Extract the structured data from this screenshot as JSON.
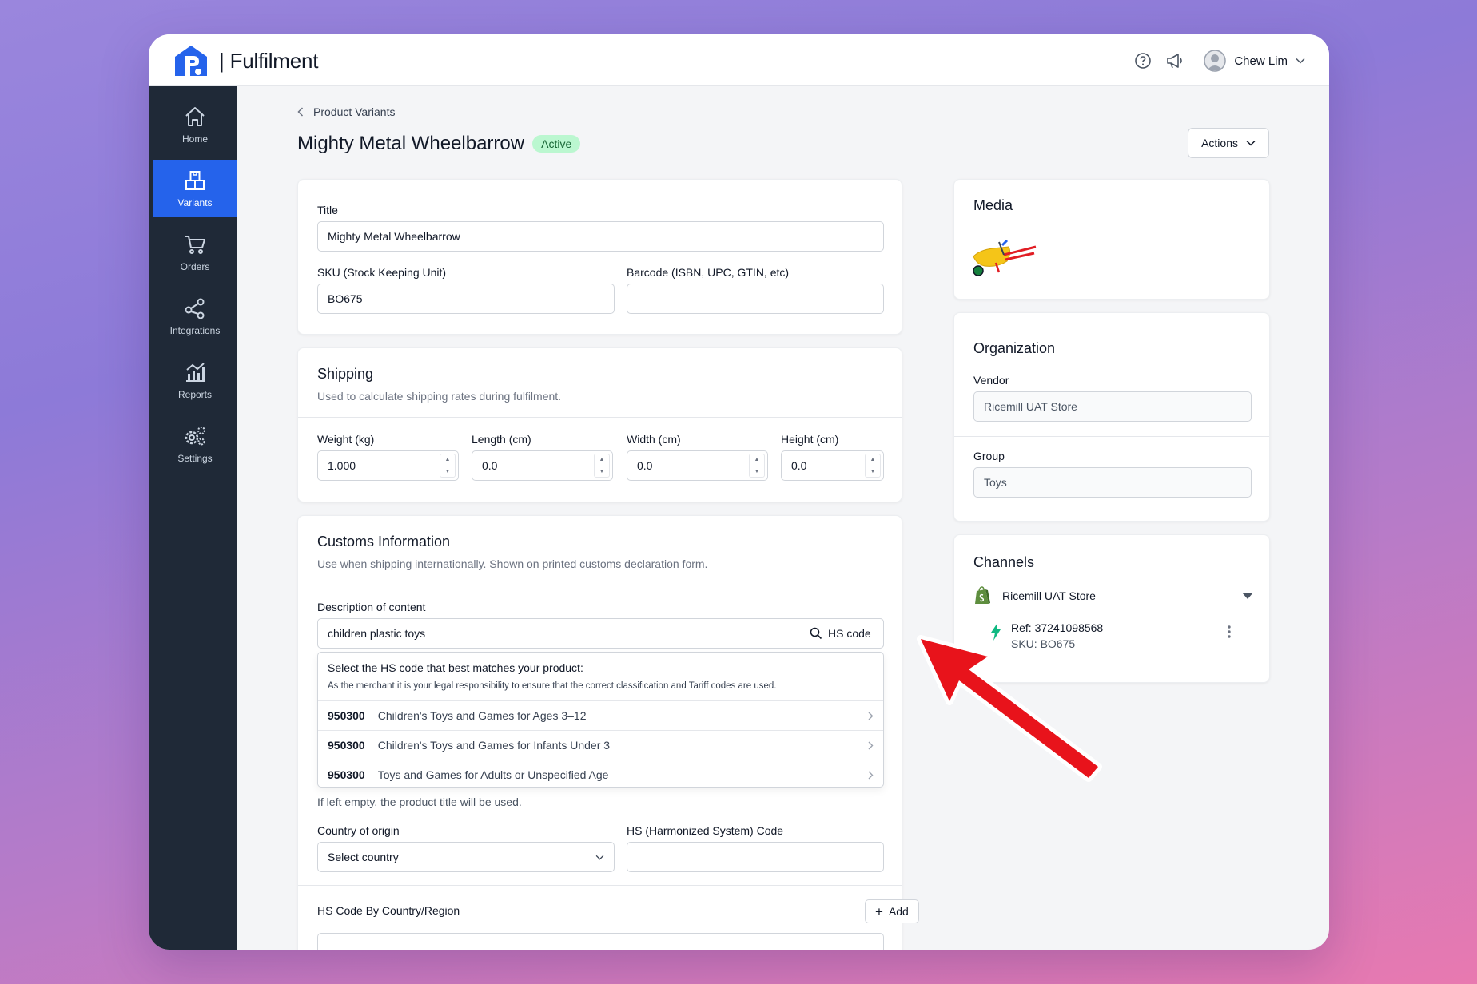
{
  "app": {
    "brand": "| Fulfilment",
    "user_name": "Chew Lim"
  },
  "icons": {
    "help": "help-circle-icon",
    "announce": "megaphone-icon",
    "user": "user-avatar-icon"
  },
  "colors": {
    "accent": "#2563eb",
    "sidebar": "#1f2937",
    "active_badge_bg": "#bbf7d0",
    "active_badge_text": "#166534",
    "annotation_arrow": "#e8131b"
  },
  "sidebar": {
    "items": [
      {
        "label": "Home",
        "icon": "home-icon"
      },
      {
        "label": "Variants",
        "icon": "variants-icon",
        "active": true
      },
      {
        "label": "Orders",
        "icon": "cart-icon"
      },
      {
        "label": "Integrations",
        "icon": "share-icon"
      },
      {
        "label": "Reports",
        "icon": "chart-icon"
      },
      {
        "label": "Settings",
        "icon": "gears-icon"
      }
    ]
  },
  "header": {
    "breadcrumb": "Product Variants",
    "title": "Mighty Metal Wheelbarrow",
    "status": "Active",
    "actions_label": "Actions"
  },
  "product": {
    "title_label": "Title",
    "title_value": "Mighty Metal Wheelbarrow",
    "sku_label": "SKU (Stock Keeping Unit)",
    "sku_value": "BO675",
    "barcode_label": "Barcode (ISBN, UPC, GTIN, etc)",
    "barcode_value": ""
  },
  "shipping": {
    "heading": "Shipping",
    "subtitle": "Used to calculate shipping rates during fulfilment.",
    "fields": [
      {
        "label": "Weight (kg)",
        "value": "1.000"
      },
      {
        "label": "Length (cm)",
        "value": "0.0"
      },
      {
        "label": "Width (cm)",
        "value": "0.0"
      },
      {
        "label": "Height (cm)",
        "value": "0.0"
      }
    ]
  },
  "customs": {
    "heading": "Customs Information",
    "subtitle": "Use when shipping internationally. Shown on printed customs declaration form.",
    "description_label": "Description of content",
    "description_value": "children plastic toys",
    "hs_button": "HS code",
    "dropdown": {
      "heading": "Select the HS code that best matches your product:",
      "note": "As the merchant it is your legal responsibility to ensure that the correct classification and Tariff codes are used.",
      "options": [
        {
          "code": "950300",
          "label": "Children's Toys and Games for Ages 3–12"
        },
        {
          "code": "950300",
          "label": "Children's Toys and Games for Infants Under 3"
        },
        {
          "code": "950300",
          "label": "Toys and Games for Adults or Unspecified Age"
        }
      ]
    },
    "helper": "If left empty, the product title will be used.",
    "country_label": "Country of origin",
    "country_value": "Select country",
    "hs_label": "HS (Harmonized System) Code",
    "hs_value": "",
    "by_country_label": "HS Code By Country/Region",
    "add_label": "Add"
  },
  "media": {
    "heading": "Media",
    "thumbnail": "wheelbarrow-image"
  },
  "organization": {
    "heading": "Organization",
    "vendor_label": "Vendor",
    "vendor_value": "Ricemill UAT Store",
    "group_label": "Group",
    "group_value": "Toys"
  },
  "channels": {
    "heading": "Channels",
    "store": "Ricemill UAT Store",
    "ref": "Ref: 37241098568",
    "sku": "SKU: BO675"
  }
}
